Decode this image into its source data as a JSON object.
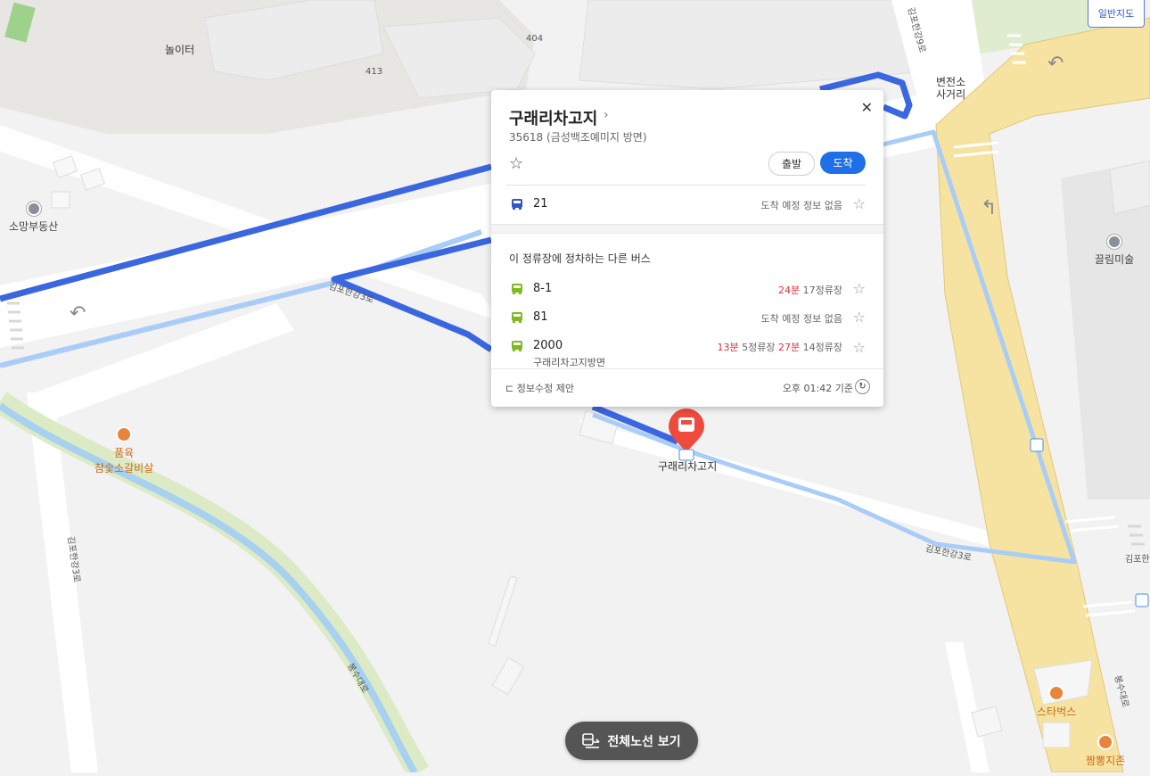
{
  "map_type_button": "일반지도",
  "panel": {
    "title": "구래리차고지",
    "subtitle": "35618 (금성백조예미지 방면)",
    "depart_label": "출발",
    "arrive_label": "도착",
    "current_bus": {
      "number": "21",
      "status": "도착 예정 정보 없음"
    },
    "other_section_title": "이 정류장에 정차하는 다른 버스",
    "other_buses": [
      {
        "number": "8-1",
        "time1": "24분",
        "stops1": "17정류장"
      },
      {
        "number": "81",
        "status": "도착 예정 정보 없음"
      },
      {
        "number": "2000",
        "time1": "13분",
        "stops1": "5정류장",
        "time2": "27분",
        "stops2": "14정류장",
        "direction": "구래리차고지방면"
      }
    ],
    "footer_suggest": "정보수정 제안",
    "footer_time": "오후 01:42 기준"
  },
  "map_labels": {
    "playground": "놀이터",
    "bldg_404": "404",
    "bldg_413": "413",
    "intersection": [
      "변전소",
      "사거리"
    ],
    "pharm": "소망부동산",
    "museum": "끌림미술",
    "restaurant1": [
      "품육",
      "참숯소갈비살"
    ],
    "stop_name": "구래리차고지",
    "road_gimpo3_top": "김포한강3로",
    "road_gimpo3_left": "김포한강3로",
    "road_gimpo3_bottom": "김포한강3로",
    "road_gimpo9": "김포한강9로",
    "road_gimpo_right": "김포한",
    "road_bongsu_left": "봉수대로",
    "road_bongsu_right": "봉수대로",
    "starbucks": "스타벅스",
    "jjamppong": "짬뽕지존"
  },
  "full_route_button": "전체노선 보기",
  "colors": {
    "route_dark": "#3a66e0",
    "route_light": "#a9cdf6",
    "main_road": "#f7e3a1",
    "accent_blue": "#1f6fe8",
    "bus_blue": "#2f55c6",
    "bus_green": "#7dba1a",
    "marker_red": "#ee4a3e"
  }
}
